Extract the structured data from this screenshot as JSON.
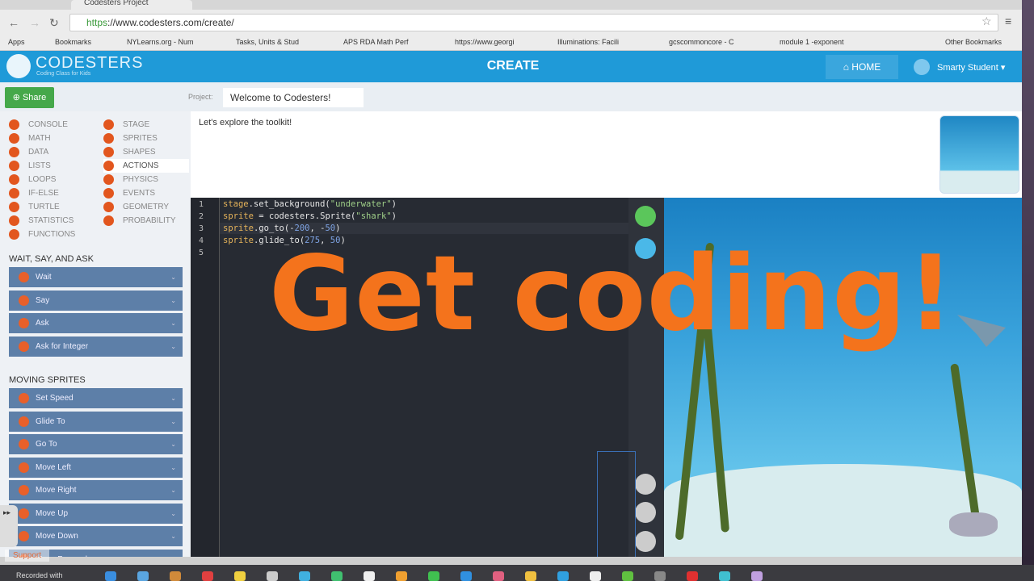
{
  "browser": {
    "tab_title": "Codesters Project",
    "url_scheme": "https",
    "url_rest": "://www.codesters.com/create/",
    "bookmarks": [
      "Apps",
      "Bookmarks",
      "NYLearns.org - Num",
      "Tasks, Units & Stud",
      "APS RDA Math Perf",
      "https://www.georgi",
      "Illuminations: Facili",
      "gcscommoncore - C",
      "module 1 -exponent",
      "Other Bookmarks"
    ]
  },
  "header": {
    "logo": "CODESTERS",
    "tagline": "Coding Class for Kids",
    "title": "CREATE",
    "home": "⌂ HOME",
    "user": "Smarty Student ▾"
  },
  "project": {
    "share": "⊕ Share",
    "label": "Project:",
    "name": "Welcome to Codesters!"
  },
  "categories_left": [
    "CONSOLE",
    "MATH",
    "DATA",
    "LISTS",
    "LOOPS",
    "IF-ELSE",
    "TURTLE",
    "STATISTICS",
    "FUNCTIONS"
  ],
  "categories_right": [
    "STAGE",
    "SPRITES",
    "SHAPES",
    "ACTIONS",
    "PHYSICS",
    "EVENTS",
    "GEOMETRY",
    "PROBABILITY"
  ],
  "active_category": "ACTIONS",
  "sections": [
    {
      "title": "WAIT, SAY, AND ASK",
      "blocks": [
        "Wait",
        "Say",
        "Ask",
        "Ask for Integer"
      ]
    },
    {
      "title": "MOVING SPRITES",
      "blocks": [
        "Set Speed",
        "Glide To",
        "Go To",
        "Move Left",
        "Move Right",
        "Move Up",
        "Move Down",
        "Move Forward"
      ]
    }
  ],
  "info_text": "Let's explore the toolkit!",
  "code": {
    "line_numbers": [
      "1",
      "2",
      "3",
      "4",
      "5"
    ],
    "l1a": "stage",
    "l1b": ".set_background(",
    "l1c": "\"underwater\"",
    "l1d": ")",
    "l2a": "sprite",
    "l2b": " = codesters.Sprite(",
    "l2c": "\"shark\"",
    "l2d": ")",
    "l3a": "sprite",
    "l3b": ".go_to(-",
    "l3c": "200",
    "l3d": ", -",
    "l3e": "50",
    "l3f": ")",
    "l4a": "sprite",
    "l4b": ".glide_to(",
    "l4c": "275",
    "l4d": ", ",
    "l4e": "50",
    "l4f": ")"
  },
  "overlay": "Get coding!",
  "support": "Support",
  "recorded": "Recorded with"
}
